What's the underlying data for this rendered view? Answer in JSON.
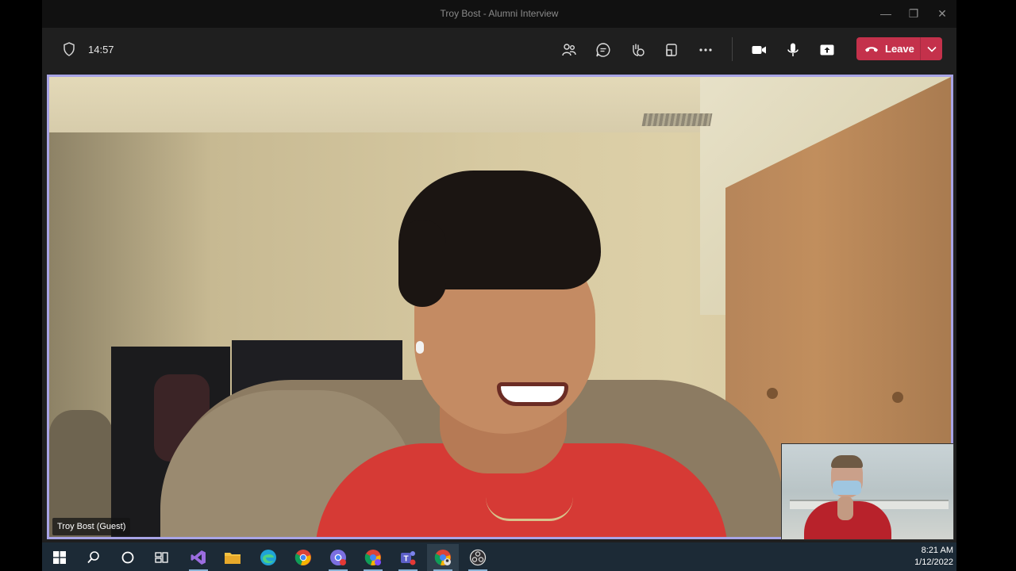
{
  "window": {
    "title": "Troy Bost - Alumni Interview"
  },
  "toolbar": {
    "timer": "14:57",
    "buttons": {
      "participants": "participants-icon",
      "chat": "chat-icon",
      "reactions": "reactions-icon",
      "rooms": "rooms-icon",
      "more": "more-icon",
      "camera": "camera-icon",
      "mic": "mic-icon",
      "share": "share-icon"
    },
    "leave_label": "Leave",
    "leave_color": "#c4314b"
  },
  "stage": {
    "participant_name": "Troy Bost (Guest)",
    "active_border_color": "#a8a4e6"
  },
  "taskbar": {
    "apps": [
      "windows-start",
      "search",
      "cortana",
      "task-view",
      "visual-studio",
      "file-explorer",
      "edge",
      "chrome",
      "chrome-profile-1",
      "chrome-profile-2",
      "teams",
      "chrome-profile-3",
      "obs"
    ],
    "time": "8:21 AM",
    "date": "1/12/2022"
  }
}
